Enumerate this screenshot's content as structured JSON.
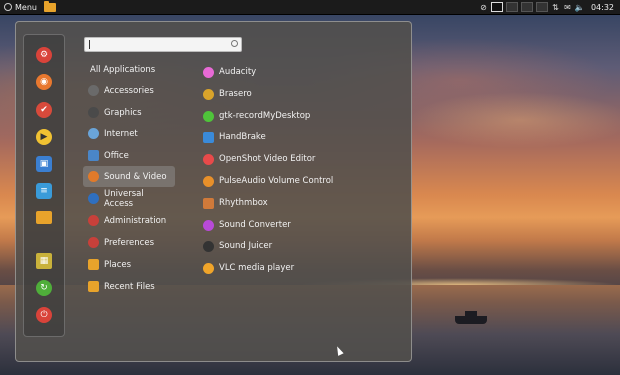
{
  "panel": {
    "menu_label": "Menu",
    "clock": "04:32",
    "workspaces": 4
  },
  "search": {
    "placeholder": ""
  },
  "favorites": [
    {
      "icon": "settings-manager-icon",
      "color": "#d9433a"
    },
    {
      "icon": "firefox-icon",
      "color": "#e8782f"
    },
    {
      "icon": "software-manager-icon",
      "color": "#d84a3b"
    },
    {
      "icon": "media-player-icon",
      "color": "#f1c232"
    },
    {
      "icon": "terminal-icon",
      "color": "#3b7fd1"
    },
    {
      "icon": "text-editor-icon",
      "color": "#3a9bd9"
    },
    {
      "icon": "files-icon",
      "color": "#e8a32b"
    },
    {
      "icon": "lock-screen-icon",
      "color": "#c9b23b"
    },
    {
      "icon": "logout-icon",
      "color": "#4fae3a"
    },
    {
      "icon": "shutdown-icon",
      "color": "#d9433a"
    }
  ],
  "categories": [
    {
      "label": "All Applications"
    },
    {
      "label": "Accessories",
      "icon": "accessories-icon",
      "color": "#6a6a6a"
    },
    {
      "label": "Graphics",
      "icon": "graphics-icon",
      "color": "#4a4a4a"
    },
    {
      "label": "Internet",
      "icon": "internet-icon",
      "color": "#6aa4d8"
    },
    {
      "label": "Office",
      "icon": "office-icon",
      "color": "#4a86c8"
    },
    {
      "label": "Sound & Video",
      "icon": "sound-video-icon",
      "color": "#e07a2a"
    },
    {
      "label": "Universal Access",
      "icon": "universal-access-icon",
      "color": "#2f6fbf"
    },
    {
      "label": "Administration",
      "icon": "administration-icon",
      "color": "#c8403a"
    },
    {
      "label": "Preferences",
      "icon": "preferences-icon",
      "color": "#c8403a"
    },
    {
      "label": "Places",
      "icon": "places-icon",
      "color": "#e8a32b"
    },
    {
      "label": "Recent Files",
      "icon": "recent-files-icon",
      "color": "#e8a32b"
    }
  ],
  "apps": [
    {
      "label": "Audacity",
      "icon": "audacity-icon",
      "color": "#e86ad6"
    },
    {
      "label": "Brasero",
      "icon": "brasero-icon",
      "color": "#d9a32a"
    },
    {
      "label": "gtk-recordMyDesktop",
      "icon": "recordmydesktop-icon",
      "color": "#4fc43a"
    },
    {
      "label": "HandBrake",
      "icon": "handbrake-icon",
      "color": "#3a8ad9"
    },
    {
      "label": "OpenShot Video Editor",
      "icon": "openshot-icon",
      "color": "#e84a4a"
    },
    {
      "label": "PulseAudio Volume Control",
      "icon": "pulseaudio-icon",
      "color": "#e8902a"
    },
    {
      "label": "Rhythmbox",
      "icon": "rhythmbox-icon",
      "color": "#d07a3a"
    },
    {
      "label": "Sound Converter",
      "icon": "sound-converter-icon",
      "color": "#b84ad8"
    },
    {
      "label": "Sound Juicer",
      "icon": "sound-juicer-icon",
      "color": "#333333"
    },
    {
      "label": "VLC media player",
      "icon": "vlc-icon",
      "color": "#f0a52a"
    }
  ]
}
